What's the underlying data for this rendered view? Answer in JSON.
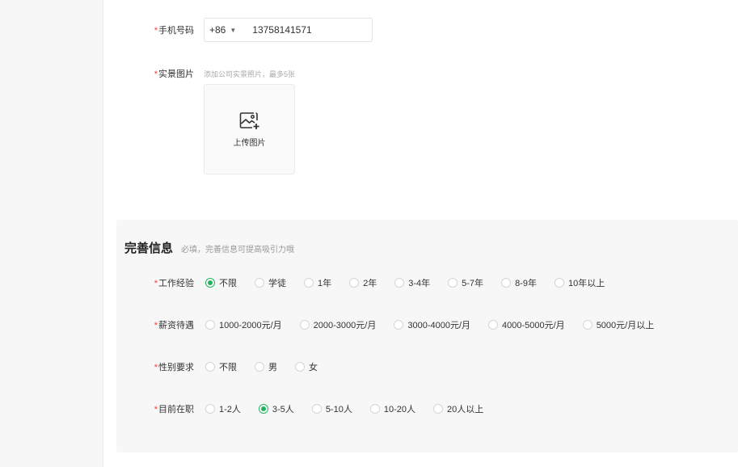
{
  "required_mark": "*",
  "phone": {
    "label": "手机号码",
    "country_code": "+86",
    "value": "13758141571"
  },
  "photos": {
    "label": "实景图片",
    "hint": "添加公司实景照片，最多5张",
    "upload_label": "上传图片"
  },
  "panel": {
    "title": "完善信息",
    "subtitle": "必填，完善信息可提高吸引力哦"
  },
  "experience": {
    "label": "工作经验",
    "options": [
      "不限",
      "学徒",
      "1年",
      "2年",
      "3-4年",
      "5-7年",
      "8-9年",
      "10年以上"
    ],
    "selected": 0
  },
  "salary": {
    "label": "薪资待遇",
    "options": [
      "1000-2000元/月",
      "2000-3000元/月",
      "3000-4000元/月",
      "4000-5000元/月",
      "5000元/月以上"
    ],
    "selected": -1
  },
  "gender": {
    "label": "性别要求",
    "options": [
      "不限",
      "男",
      "女"
    ],
    "selected": -1
  },
  "staff": {
    "label": "目前在职",
    "options": [
      "1-2人",
      "3-5人",
      "5-10人",
      "10-20人",
      "20人以上"
    ],
    "selected": 1
  },
  "colors": {
    "accent": "#22b35e",
    "required": "#ff3b30"
  },
  "icons": {
    "caret": "caret-down-icon",
    "upload": "image-add-icon"
  }
}
